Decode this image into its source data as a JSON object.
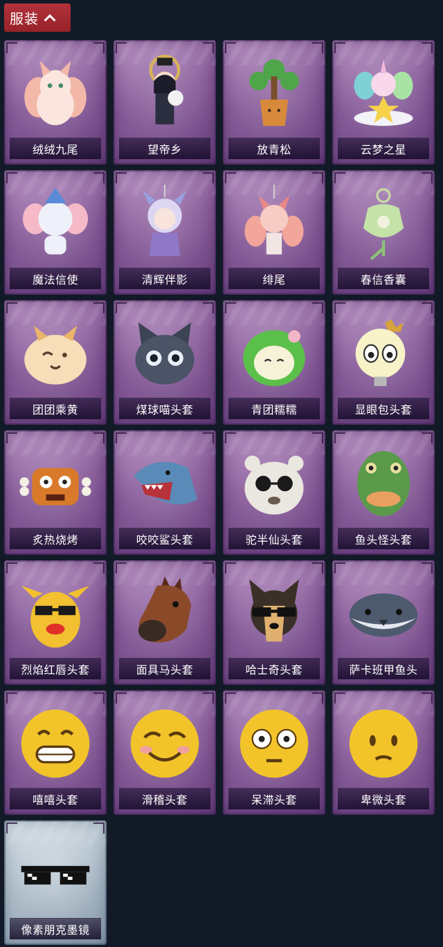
{
  "section": {
    "title": "服装",
    "toggle": "collapse"
  },
  "items": [
    {
      "name": "绒绒九尾",
      "icon": "nine-tailed-fox-icon"
    },
    {
      "name": "望帝乡",
      "icon": "doll-figure-icon"
    },
    {
      "name": "放青松",
      "icon": "potted-pine-icon"
    },
    {
      "name": "云梦之星",
      "icon": "unicorn-star-icon"
    },
    {
      "name": "魔法信使",
      "icon": "magic-elephant-icon"
    },
    {
      "name": "清辉伴影",
      "icon": "silver-doll-pendant-icon"
    },
    {
      "name": "绯尾",
      "icon": "pink-fox-pendant-icon"
    },
    {
      "name": "春信香囊",
      "icon": "sachet-icon"
    },
    {
      "name": "团团乘黄",
      "icon": "round-creature-icon"
    },
    {
      "name": "煤球喵头套",
      "icon": "black-cat-head-icon"
    },
    {
      "name": "青团糯糯",
      "icon": "green-dumpling-icon"
    },
    {
      "name": "显眼包头套",
      "icon": "bulb-head-icon"
    },
    {
      "name": "炙热烧烤",
      "icon": "meat-bone-icon"
    },
    {
      "name": "咬咬鲨头套",
      "icon": "shark-head-icon"
    },
    {
      "name": "驼半仙头套",
      "icon": "alpaca-sunglasses-icon"
    },
    {
      "name": "鱼头怪头套",
      "icon": "fish-head-icon"
    },
    {
      "name": "烈焰红唇头套",
      "icon": "yellow-red-lips-head-icon"
    },
    {
      "name": "面具马头套",
      "icon": "horse-mask-icon"
    },
    {
      "name": "哈士奇头套",
      "icon": "husky-sunglasses-icon"
    },
    {
      "name": "萨卡班甲鱼头",
      "icon": "sacabambaspis-icon"
    },
    {
      "name": "嘻嘻头套",
      "icon": "grin-emoji-icon"
    },
    {
      "name": "滑稽头套",
      "icon": "smirk-emoji-icon"
    },
    {
      "name": "呆滞头套",
      "icon": "stare-emoji-icon"
    },
    {
      "name": "卑微头套",
      "icon": "shy-emoji-icon"
    },
    {
      "name": "像素朋克墨镜",
      "icon": "pixel-sunglasses-icon"
    }
  ]
}
